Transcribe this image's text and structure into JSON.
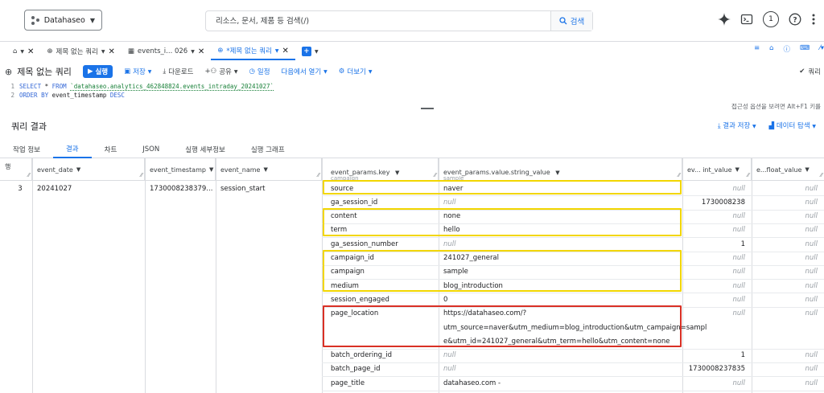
{
  "topbar": {
    "project_name": "Datahaseo",
    "search_placeholder": "리소스, 문서, 제품 등 검색(/)",
    "search_button": "검색",
    "notification_count": "1"
  },
  "tabs": [
    {
      "label": "제목 없는 쿼리"
    },
    {
      "label": "events_i... 026"
    },
    {
      "label": "*제목 없는 쿼리"
    }
  ],
  "toolbar": {
    "title": "제목 없는 쿼리",
    "run": "실행",
    "save": "저장",
    "download": "다운로드",
    "share": "공유",
    "schedule": "일정",
    "open_in": "다음에서 열기",
    "more": "더보기",
    "right_label": "쿼리"
  },
  "editor": {
    "lines": [
      {
        "num": "1",
        "kw1": "SELECT",
        "mid": " * ",
        "kw2": "FROM",
        "str": "`datahaseo.analytics_462848824.events_intraday_20241027`"
      },
      {
        "num": "2",
        "kw1": "ORDER BY",
        "mid": " event_timestamp ",
        "kw2": "DESC",
        "str": ""
      }
    ],
    "hint": "접근성 옵션을 보려면 Alt+F1 키를"
  },
  "results": {
    "title": "쿼리 결과",
    "save_results": "결과 저장",
    "explore_data": "데이터 탐색",
    "subtabs": [
      "작업 정보",
      "결과",
      "차트",
      "JSON",
      "실행 세부정보",
      "실행 그래프"
    ],
    "active_subtab": 1
  },
  "table": {
    "headers": {
      "row": "행",
      "event_date": "event_date",
      "event_timestamp": "event_timestamp",
      "event_name": "event_name",
      "key": "event_params.key",
      "string_value": "event_params.value.string_value",
      "int_value": "ev... int_value",
      "float_value": "e...float_value",
      "key_prev": "campaign",
      "string_prev": "sample"
    },
    "row_num": "3",
    "event_date": "20241027",
    "event_timestamp": "1730008238379...",
    "event_name": "session_start",
    "params": [
      {
        "key": "source",
        "string": "naver",
        "int": "null",
        "float": "null"
      },
      {
        "key": "ga_session_id",
        "string": "null",
        "int": "1730008238",
        "float": "null"
      },
      {
        "key": "content",
        "string": "none",
        "int": "null",
        "float": "null"
      },
      {
        "key": "term",
        "string": "hello",
        "int": "null",
        "float": "null"
      },
      {
        "key": "ga_session_number",
        "string": "null",
        "int": "1",
        "float": "null"
      },
      {
        "key": "campaign_id",
        "string": "241027_general",
        "int": "null",
        "float": "null"
      },
      {
        "key": "campaign",
        "string": "sample",
        "int": "null",
        "float": "null"
      },
      {
        "key": "medium",
        "string": "blog_introduction",
        "int": "null",
        "float": "null"
      },
      {
        "key": "session_engaged",
        "string": "0",
        "int": "null",
        "float": "null"
      },
      {
        "key": "page_location",
        "string_lines": [
          "https://datahaseo.com/?",
          "utm_source=naver&utm_medium=blog_introduction&utm_campaign=sampl",
          "e&utm_id=241027_general&utm_term=hello&utm_content=none"
        ],
        "int": "null",
        "float": "null"
      },
      {
        "key": "batch_ordering_id",
        "string": "null",
        "int": "1",
        "float": "null"
      },
      {
        "key": "batch_page_id",
        "string": "null",
        "int": "1730008237835",
        "float": "null"
      },
      {
        "key": "page_title",
        "string": "datahaseo.com -",
        "int": "null",
        "float": "null"
      }
    ]
  },
  "colors": {
    "accent": "#1a73e8",
    "highlight_yellow": "#f2d600",
    "highlight_red": "#d93025"
  }
}
